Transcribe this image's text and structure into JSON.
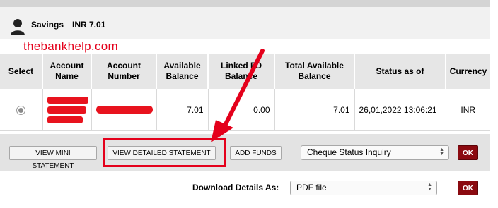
{
  "account": {
    "type": "Savings",
    "balance_text": "INR 7.01"
  },
  "watermark": "thebankhelp.com",
  "table": {
    "headers": {
      "select": "Select",
      "account_name": "Account Name",
      "account_number": "Account Number",
      "available_balance": "Available Balance",
      "linked_fd_balance": "Linked FD Balance",
      "total_available_balance": "Total Available Balance",
      "status_as_of": "Status as of",
      "currency": "Currency"
    },
    "row": {
      "selected": true,
      "account_name": "[redacted]",
      "account_number": "[redacted]",
      "available_balance": "7.01",
      "linked_fd_balance": "0.00",
      "total_available_balance": "7.01",
      "status_as_of": "26,01,2022 13:06:21",
      "currency": "INR"
    }
  },
  "actions": {
    "view_mini_statement": "VIEW MINI STATEMENT",
    "view_detailed_statement": "VIEW DETAILED STATEMENT",
    "add_funds": "ADD FUNDS",
    "service_select": "Cheque Status Inquiry",
    "ok_label": "OK"
  },
  "download": {
    "label": "Download Details As:",
    "format_select": "PDF file",
    "ok_label": "OK"
  },
  "colors": {
    "annotation_red": "#e4001b",
    "ok_button": "#8b0a10",
    "header_bg": "#e6e6e6",
    "action_bar_bg": "#e3e3e3"
  },
  "icons": [
    "person-icon",
    "radio-selected-icon",
    "select-spinner-icon",
    "annotation-arrow-icon"
  ]
}
